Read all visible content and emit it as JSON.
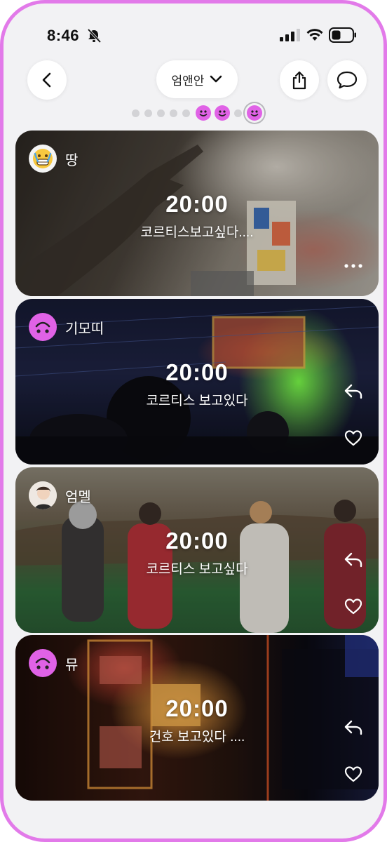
{
  "status_bar": {
    "time": "8:46",
    "icons": [
      "bell-slash-icon",
      "cellular-signal-icon",
      "wifi-icon",
      "battery-icon"
    ]
  },
  "nav": {
    "group_name": "엄앤안",
    "icons": [
      "back-arrow-icon",
      "chevron-down-icon",
      "share-icon",
      "chat-bubble-icon"
    ]
  },
  "pager": {
    "plain_dots": 5,
    "face_dots": 3,
    "active_index": 7
  },
  "posts": [
    {
      "user": "땅",
      "avatar": "grimace-emoji-avatar",
      "time": "20:00",
      "message": "코르티스보고싶다....",
      "actions": [
        "more-icon"
      ]
    },
    {
      "user": "기모띠",
      "avatar": "pink-upside-down-smiley-avatar",
      "time": "20:00",
      "message": "코르티스 보고있다",
      "actions": [
        "reply-icon",
        "heart-icon"
      ]
    },
    {
      "user": "엄멜",
      "avatar": "person-photo-avatar",
      "time": "20:00",
      "message": "코르티스 보고싶다",
      "actions": [
        "reply-icon",
        "heart-icon"
      ]
    },
    {
      "user": "뮤",
      "avatar": "pink-upside-down-smiley-avatar",
      "time": "20:00",
      "message": "건호 보고있다 ....",
      "actions": [
        "reply-icon",
        "heart-icon"
      ]
    }
  ],
  "colors": {
    "accent": "#e062e6",
    "frame": "#e27ae9",
    "background": "#f2f2f4"
  }
}
